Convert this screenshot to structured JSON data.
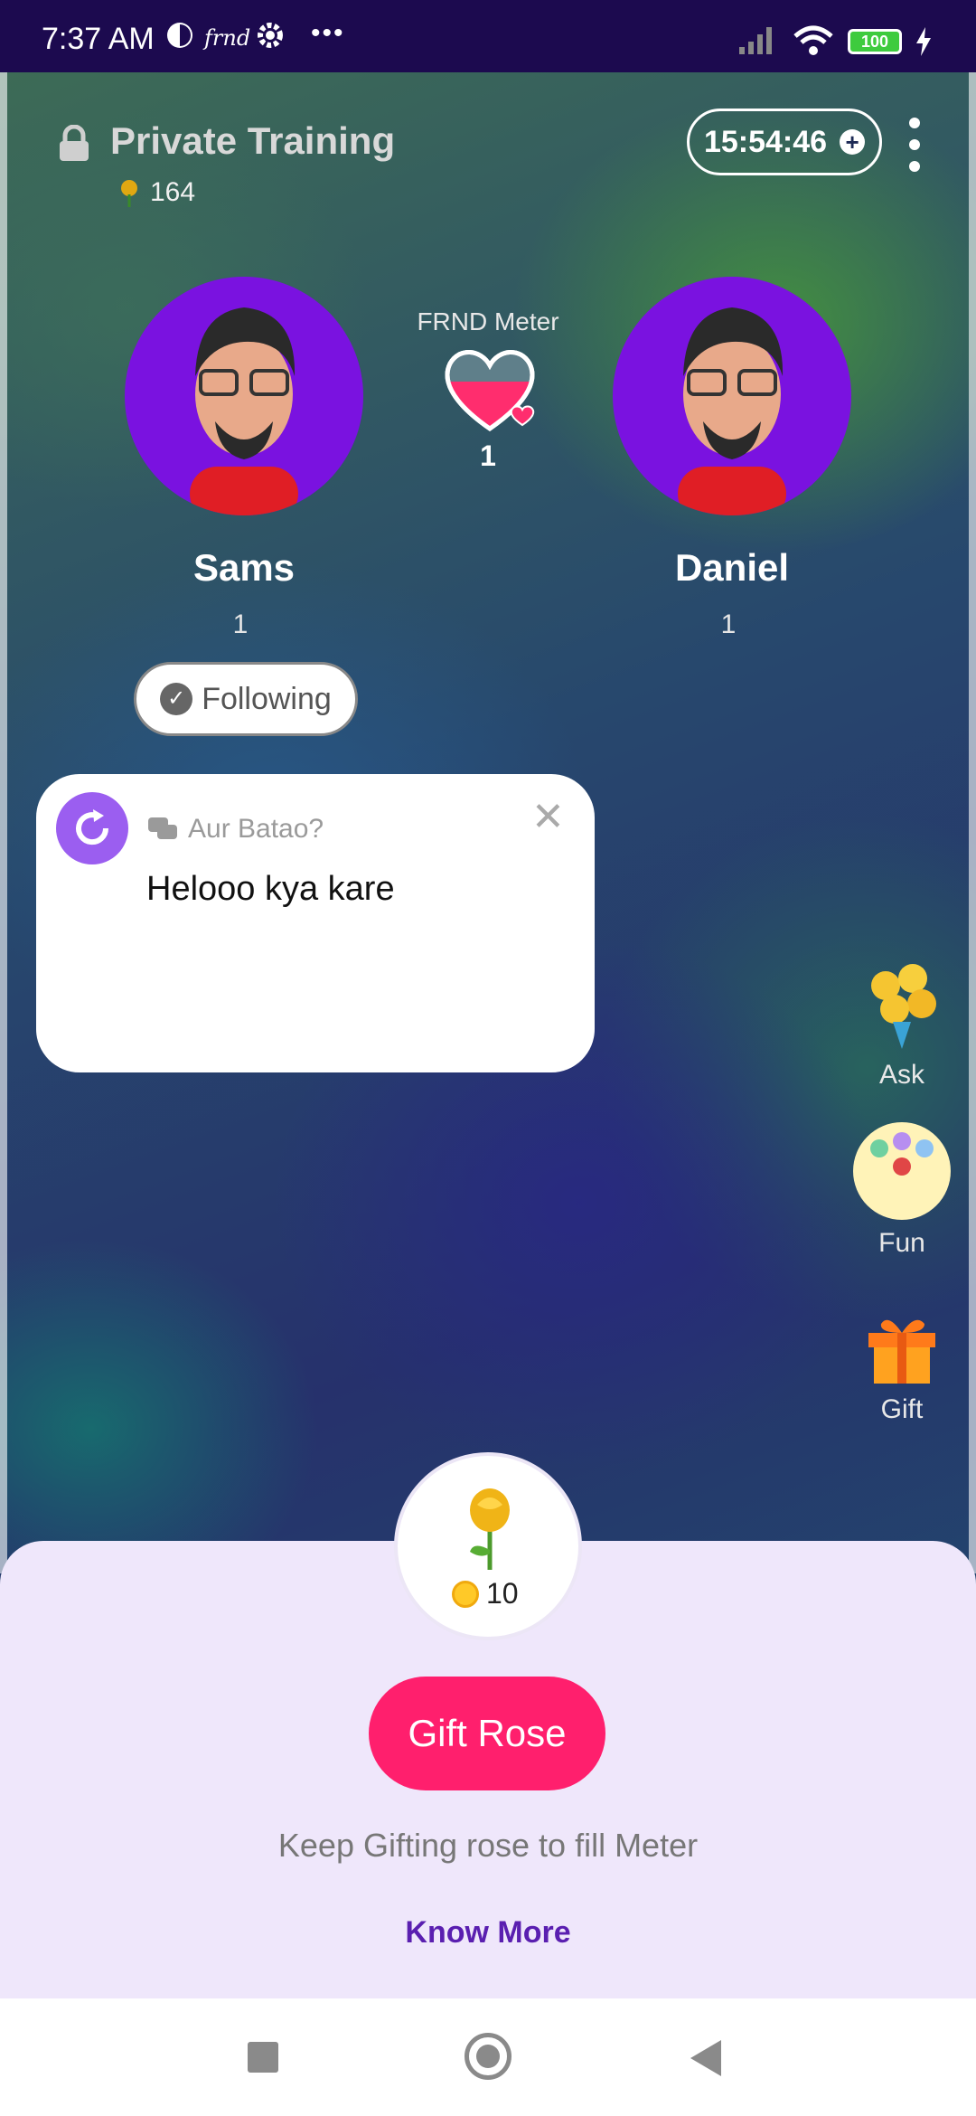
{
  "status_bar": {
    "time": "7:37 AM",
    "app_tag": "frnd",
    "battery": "100"
  },
  "header": {
    "title": "Private Training",
    "rose_count": "164",
    "timer": "15:54:46"
  },
  "users": [
    {
      "name": "Sams",
      "count": "1"
    },
    {
      "name": "Daniel",
      "count": "1"
    }
  ],
  "meter": {
    "label": "FRND Meter",
    "value": "1"
  },
  "follow": {
    "label": "Following"
  },
  "card": {
    "prompt": "Aur Batao?",
    "message": "Helooo kya kare"
  },
  "side_actions": [
    {
      "label": "Ask",
      "icon": "bouquet-icon"
    },
    {
      "label": "Fun",
      "icon": "bingo-balls-icon"
    },
    {
      "label": "Gift",
      "icon": "gift-box-icon"
    }
  ],
  "gift_sheet": {
    "price": "10",
    "button": "Gift Rose",
    "hint": "Keep Gifting rose to fill Meter",
    "link": "Know More"
  },
  "colors": {
    "accent_pink": "#ff1f6d",
    "avatar_purple": "#7a12e0",
    "link_purple": "#5a1fb0",
    "sheet_bg": "#efe7fb"
  }
}
